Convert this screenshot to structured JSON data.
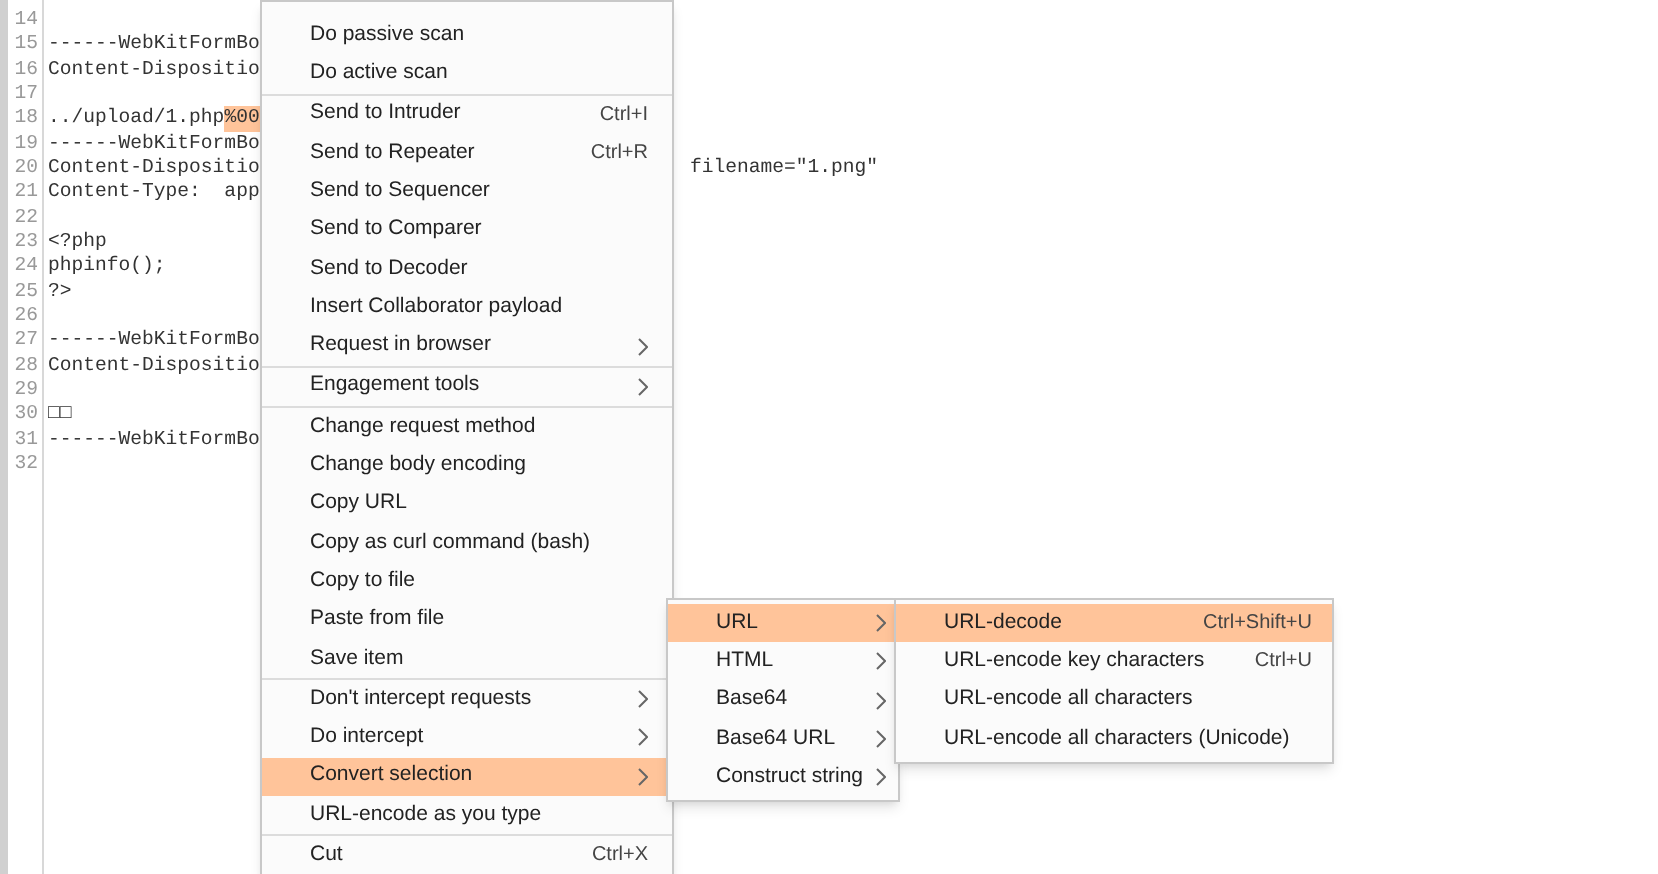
{
  "editor": {
    "lines": [
      {
        "number": "14"
      },
      {
        "number": "15",
        "text": "------WebKitFormBo"
      },
      {
        "number": "16",
        "text": "Content-Dispositio"
      },
      {
        "number": "17"
      },
      {
        "number": "18",
        "text": "../upload/1.php",
        "selection": "%00"
      },
      {
        "number": "19",
        "text": "------WebKitFormBo"
      },
      {
        "number": "20",
        "text": "Content-Dispositio",
        "tail": "filename=\"1.png\""
      },
      {
        "number": "21",
        "text": "Content-Type:  app"
      },
      {
        "number": "22"
      },
      {
        "number": "23",
        "text": "<?php"
      },
      {
        "number": "24",
        "text": "phpinfo();"
      },
      {
        "number": "25",
        "text": "?>"
      },
      {
        "number": "26"
      },
      {
        "number": "27",
        "text": "------WebKitFormBo"
      },
      {
        "number": "28",
        "text": "Content-Dispositio"
      },
      {
        "number": "29"
      },
      {
        "number": "30",
        "text": "□□"
      },
      {
        "number": "31",
        "text": "------WebKitFormBo"
      },
      {
        "number": "32"
      }
    ]
  },
  "context_menu": {
    "groups": [
      [
        {
          "label": "Do passive scan",
          "selected": false,
          "submenu": false
        },
        {
          "label": "Do active scan",
          "selected": false,
          "submenu": false
        }
      ],
      [
        {
          "label": "Send to Intruder",
          "shortcut": "Ctrl+I",
          "selected": false,
          "submenu": false
        },
        {
          "label": "Send to Repeater",
          "shortcut": "Ctrl+R",
          "selected": false,
          "submenu": false
        },
        {
          "label": "Send to Sequencer",
          "selected": false,
          "submenu": false
        },
        {
          "label": "Send to Comparer",
          "selected": false,
          "submenu": false
        },
        {
          "label": "Send to Decoder",
          "selected": false,
          "submenu": false
        },
        {
          "label": "Insert Collaborator payload",
          "selected": false,
          "submenu": false
        },
        {
          "label": "Request in browser",
          "selected": false,
          "submenu": true
        }
      ],
      [
        {
          "label": "Engagement tools",
          "selected": false,
          "submenu": true
        }
      ],
      [
        {
          "label": "Change request method",
          "selected": false,
          "submenu": false
        },
        {
          "label": "Change body encoding",
          "selected": false,
          "submenu": false
        },
        {
          "label": "Copy URL",
          "selected": false,
          "submenu": false
        },
        {
          "label": "Copy as curl command (bash)",
          "selected": false,
          "submenu": false
        },
        {
          "label": "Copy to file",
          "selected": false,
          "submenu": false
        },
        {
          "label": "Paste from file",
          "selected": false,
          "submenu": false
        },
        {
          "label": "Save item",
          "selected": false,
          "submenu": false
        }
      ],
      [
        {
          "label": "Don't intercept requests",
          "selected": false,
          "submenu": true
        },
        {
          "label": "Do intercept",
          "selected": false,
          "submenu": true
        },
        {
          "label": "Convert selection",
          "selected": true,
          "submenu": true
        },
        {
          "label": "URL-encode as you type",
          "selected": false,
          "submenu": false
        }
      ],
      [
        {
          "label": "Cut",
          "shortcut": "Ctrl+X",
          "selected": false,
          "submenu": false
        }
      ]
    ]
  },
  "convert_submenu": {
    "items": [
      {
        "label": "URL",
        "selected": true,
        "submenu": true
      },
      {
        "label": "HTML",
        "selected": false,
        "submenu": true
      },
      {
        "label": "Base64",
        "selected": false,
        "submenu": true
      },
      {
        "label": "Base64 URL",
        "selected": false,
        "submenu": true
      },
      {
        "label": "Construct string",
        "selected": false,
        "submenu": true
      }
    ]
  },
  "url_submenu": {
    "items": [
      {
        "label": "URL-decode",
        "shortcut": "Ctrl+Shift+U",
        "selected": true,
        "submenu": false
      },
      {
        "label": "URL-encode key characters",
        "shortcut": "Ctrl+U",
        "selected": false,
        "submenu": false
      },
      {
        "label": "URL-encode all characters",
        "selected": false,
        "submenu": false
      },
      {
        "label": "URL-encode all characters (Unicode)",
        "selected": false,
        "submenu": false
      }
    ]
  }
}
